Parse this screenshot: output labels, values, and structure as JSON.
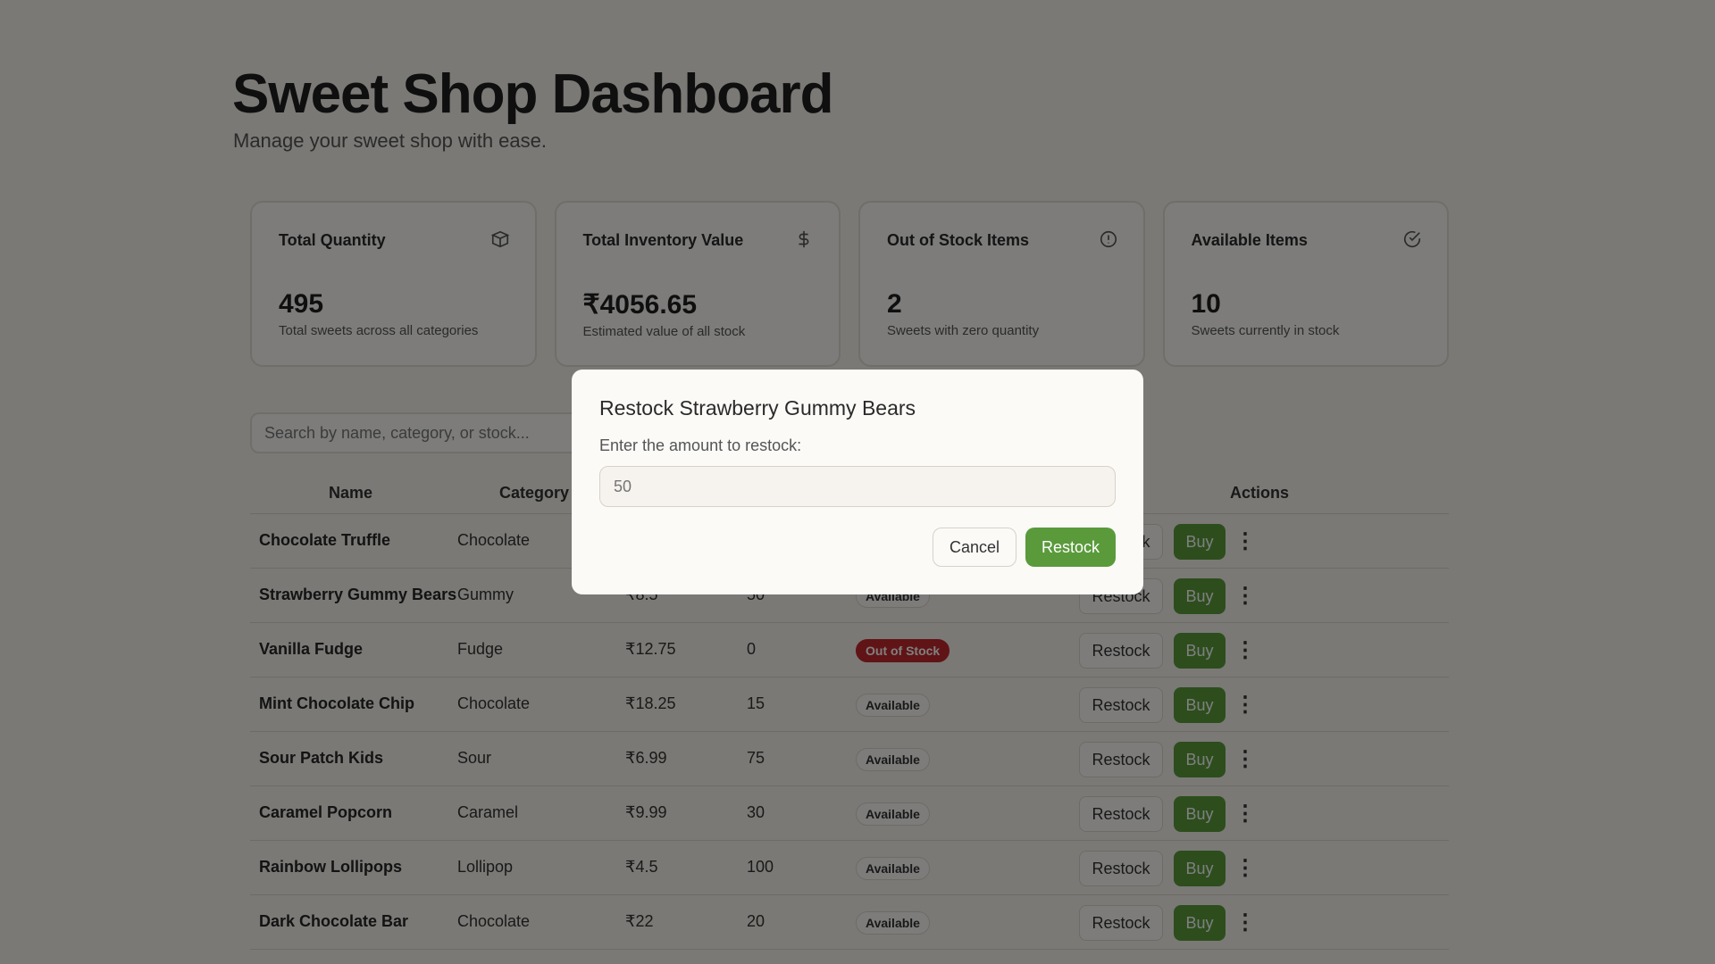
{
  "header": {
    "title": "Sweet Shop Dashboard",
    "subtitle": "Manage your sweet shop with ease."
  },
  "stats": [
    {
      "title": "Total Quantity",
      "value": "495",
      "desc": "Total sweets across all categories",
      "icon": "box-icon"
    },
    {
      "title": "Total Inventory Value",
      "value": "₹4056.65",
      "desc": "Estimated value of all stock",
      "icon": "dollar-icon"
    },
    {
      "title": "Out of Stock Items",
      "value": "2",
      "desc": "Sweets with zero quantity",
      "icon": "alert-circle-icon"
    },
    {
      "title": "Available Items",
      "value": "10",
      "desc": "Sweets currently in stock",
      "icon": "check-circle-icon"
    }
  ],
  "search": {
    "placeholder": "Search by name, category, or stock..."
  },
  "table": {
    "headers": {
      "name": "Name",
      "category": "Category",
      "actions": "Actions"
    },
    "restock_label": "Restock",
    "buy_label": "Buy",
    "more_label": "⋮",
    "rows": [
      {
        "name": "Chocolate Truffle",
        "category": "Chocolate",
        "price": "",
        "qty": "",
        "status": "",
        "status_type": "available"
      },
      {
        "name": "Strawberry Gummy Bears",
        "category": "Gummy",
        "price": "₹8.5",
        "qty": "50",
        "status": "Available",
        "status_type": "available"
      },
      {
        "name": "Vanilla Fudge",
        "category": "Fudge",
        "price": "₹12.75",
        "qty": "0",
        "status": "Out of Stock",
        "status_type": "out"
      },
      {
        "name": "Mint Chocolate Chip",
        "category": "Chocolate",
        "price": "₹18.25",
        "qty": "15",
        "status": "Available",
        "status_type": "available"
      },
      {
        "name": "Sour Patch Kids",
        "category": "Sour",
        "price": "₹6.99",
        "qty": "75",
        "status": "Available",
        "status_type": "available"
      },
      {
        "name": "Caramel Popcorn",
        "category": "Caramel",
        "price": "₹9.99",
        "qty": "30",
        "status": "Available",
        "status_type": "available"
      },
      {
        "name": "Rainbow Lollipops",
        "category": "Lollipop",
        "price": "₹4.5",
        "qty": "100",
        "status": "Available",
        "status_type": "available"
      },
      {
        "name": "Dark Chocolate Bar",
        "category": "Chocolate",
        "price": "₹22",
        "qty": "20",
        "status": "Available",
        "status_type": "available"
      }
    ]
  },
  "modal": {
    "title": "Restock Strawberry Gummy Bears",
    "label": "Enter the amount to restock:",
    "input_placeholder": "50",
    "cancel_label": "Cancel",
    "confirm_label": "Restock"
  },
  "colors": {
    "accent": "#5a9a3b",
    "danger": "#c0282c",
    "background": "#f5f2ec"
  }
}
